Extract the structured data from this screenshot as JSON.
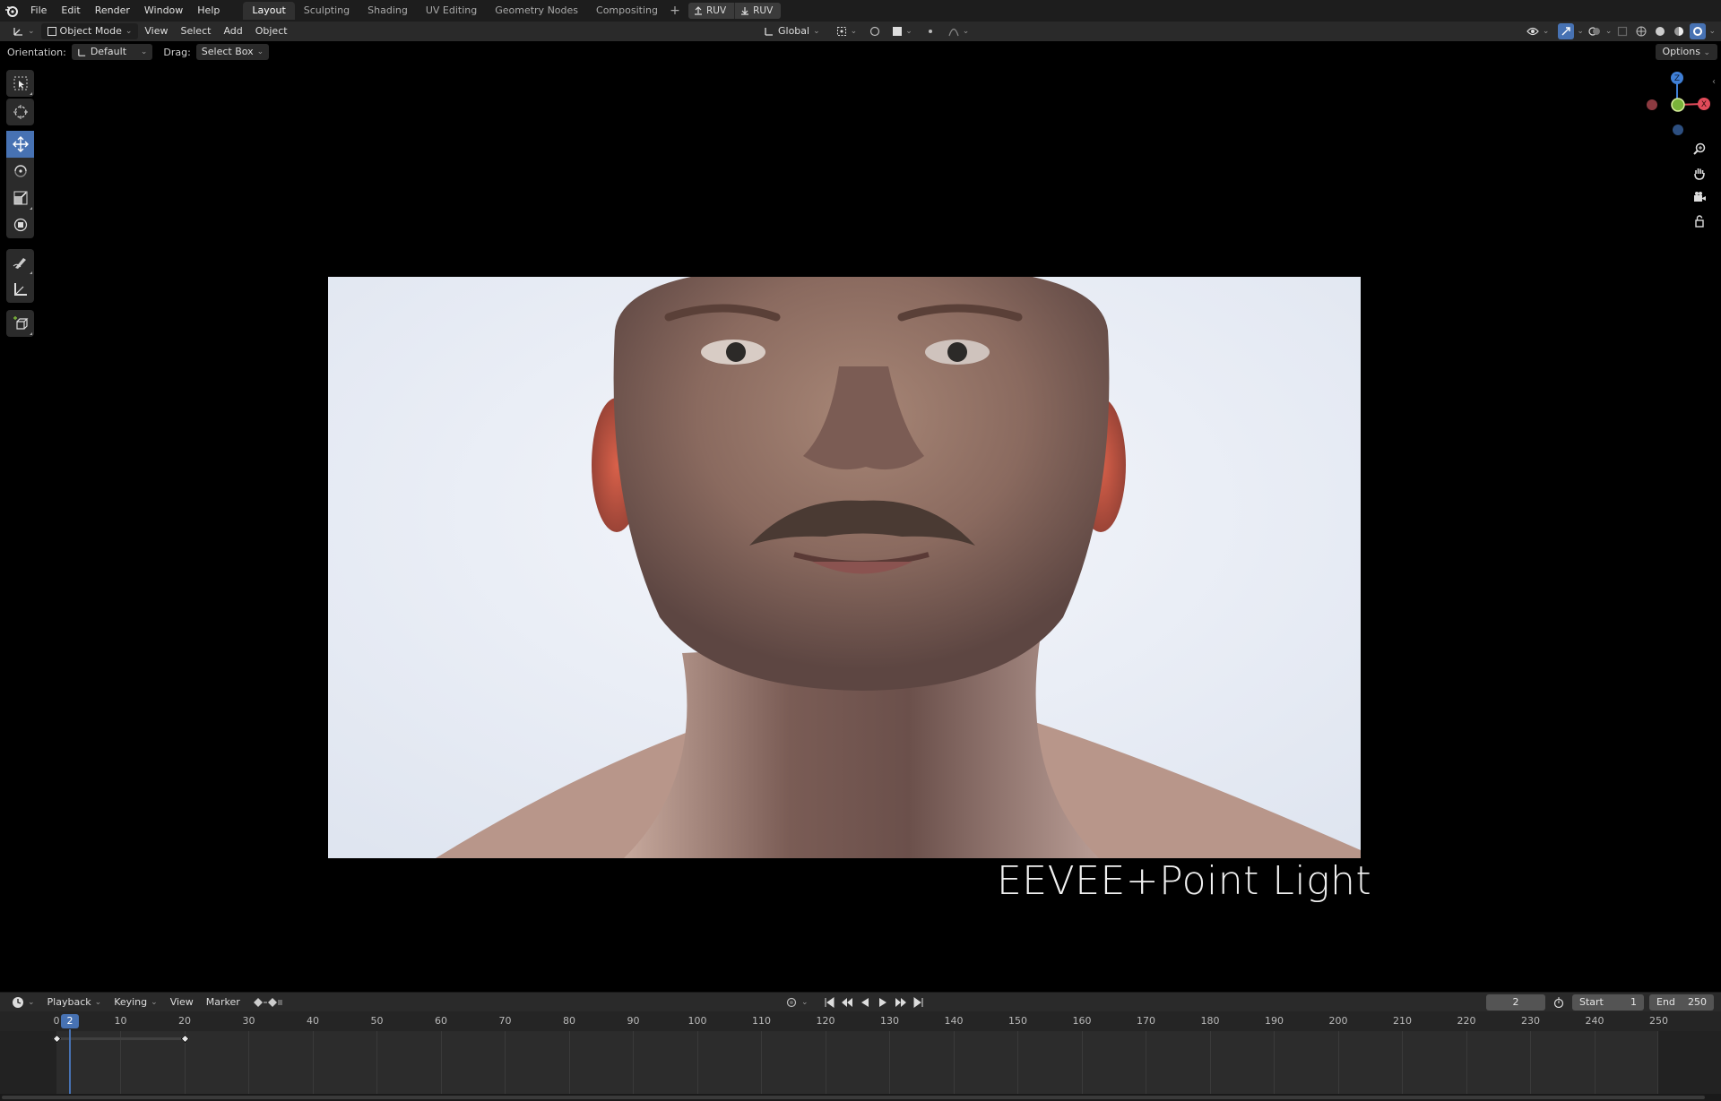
{
  "menu": {
    "items": [
      "File",
      "Edit",
      "Render",
      "Window",
      "Help"
    ]
  },
  "workspaces": {
    "tabs": [
      "Layout",
      "Sculpting",
      "Shading",
      "UV Editing",
      "Geometry Nodes",
      "Compositing"
    ],
    "active": "Layout",
    "add_label": "+"
  },
  "ruv": {
    "upload_label": "RUV",
    "download_label": "RUV"
  },
  "header": {
    "mode": "Object Mode",
    "view": "View",
    "select": "Select",
    "add": "Add",
    "object": "Object",
    "transform_orientation": "Global"
  },
  "tool_settings": {
    "orientation_label": "Orientation:",
    "orientation_value": "Default",
    "drag_label": "Drag:",
    "drag_value": "Select Box",
    "options_label": "Options"
  },
  "viewport": {
    "caption": "EEVEE+Point Light"
  },
  "timeline": {
    "playback": "Playback",
    "keying": "Keying",
    "view": "View",
    "marker": "Marker",
    "current_frame": "2",
    "start_label": "Start",
    "start_value": "1",
    "end_label": "End",
    "end_value": "250",
    "ticks": [
      "0",
      "10",
      "20",
      "30",
      "40",
      "50",
      "60",
      "70",
      "80",
      "90",
      "100",
      "110",
      "120",
      "130",
      "140",
      "150",
      "160",
      "170",
      "180",
      "190",
      "200",
      "210",
      "220",
      "230",
      "240",
      "250"
    ],
    "playhead_label": "2"
  },
  "colors": {
    "accent": "#4772b3",
    "axis_x": "#e24b5a",
    "axis_y": "#7ab33a",
    "axis_z": "#3f7fd6"
  }
}
